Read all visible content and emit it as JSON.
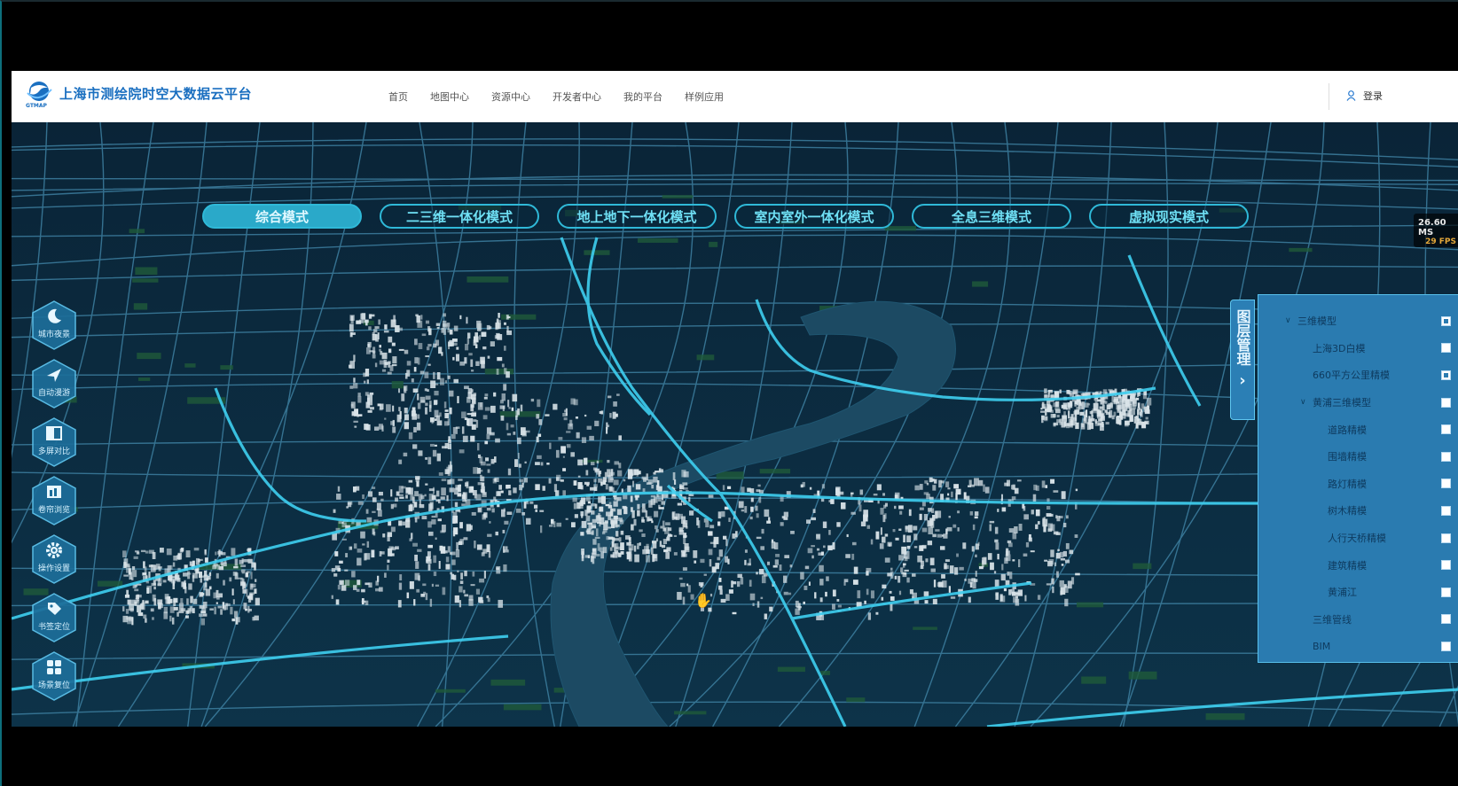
{
  "header": {
    "logo_text": "上海市测绘院时空大数据云平台",
    "logo_sub": "GTMAP",
    "nav": [
      "首页",
      "地图中心",
      "资源中心",
      "开发者中心",
      "我的平台",
      "样例应用"
    ],
    "login_label": "登录"
  },
  "modes": [
    {
      "label": "综合模式",
      "active": true
    },
    {
      "label": "二三维一体化模式",
      "active": false
    },
    {
      "label": "地上地下一体化模式",
      "active": false
    },
    {
      "label": "室内室外一体化模式",
      "active": false
    },
    {
      "label": "全息三维模式",
      "active": false
    },
    {
      "label": "虚拟现实模式",
      "active": false
    }
  ],
  "fps": {
    "ms": "26.60 MS",
    "fps": "29 FPS"
  },
  "tools": [
    {
      "label": "城市夜景",
      "icon": "moon-icon"
    },
    {
      "label": "自动漫游",
      "icon": "plane-icon"
    },
    {
      "label": "多屏对比",
      "icon": "split-screen-icon"
    },
    {
      "label": "卷帘浏览",
      "icon": "swipe-icon"
    },
    {
      "label": "操作设置",
      "icon": "gear-icon"
    },
    {
      "label": "书签定位",
      "icon": "bookmark-icon"
    },
    {
      "label": "场景复位",
      "icon": "grid-icon"
    }
  ],
  "layer_tab": {
    "label": "图层管理"
  },
  "layers": [
    {
      "name": "三维模型",
      "level": 0,
      "caret": true,
      "checked": true
    },
    {
      "name": "上海3D白模",
      "level": 1,
      "caret": false,
      "checked": false
    },
    {
      "name": "660平方公里精模",
      "level": 1,
      "caret": false,
      "checked": true
    },
    {
      "name": "黄浦三维模型",
      "level": 1,
      "caret": true,
      "checked": false
    },
    {
      "name": "道路精模",
      "level": 2,
      "caret": false,
      "checked": false
    },
    {
      "name": "围墙精模",
      "level": 2,
      "caret": false,
      "checked": false
    },
    {
      "name": "路灯精模",
      "level": 2,
      "caret": false,
      "checked": false
    },
    {
      "name": "树木精模",
      "level": 2,
      "caret": false,
      "checked": false
    },
    {
      "name": "人行天桥精模",
      "level": 2,
      "caret": false,
      "checked": false
    },
    {
      "name": "建筑精模",
      "level": 2,
      "caret": false,
      "checked": false
    },
    {
      "name": "黄浦江",
      "level": 2,
      "caret": false,
      "checked": false
    },
    {
      "name": "三维管线",
      "level": 1,
      "caret": false,
      "checked": false
    },
    {
      "name": "BIM",
      "level": 1,
      "caret": false,
      "checked": false
    }
  ]
}
